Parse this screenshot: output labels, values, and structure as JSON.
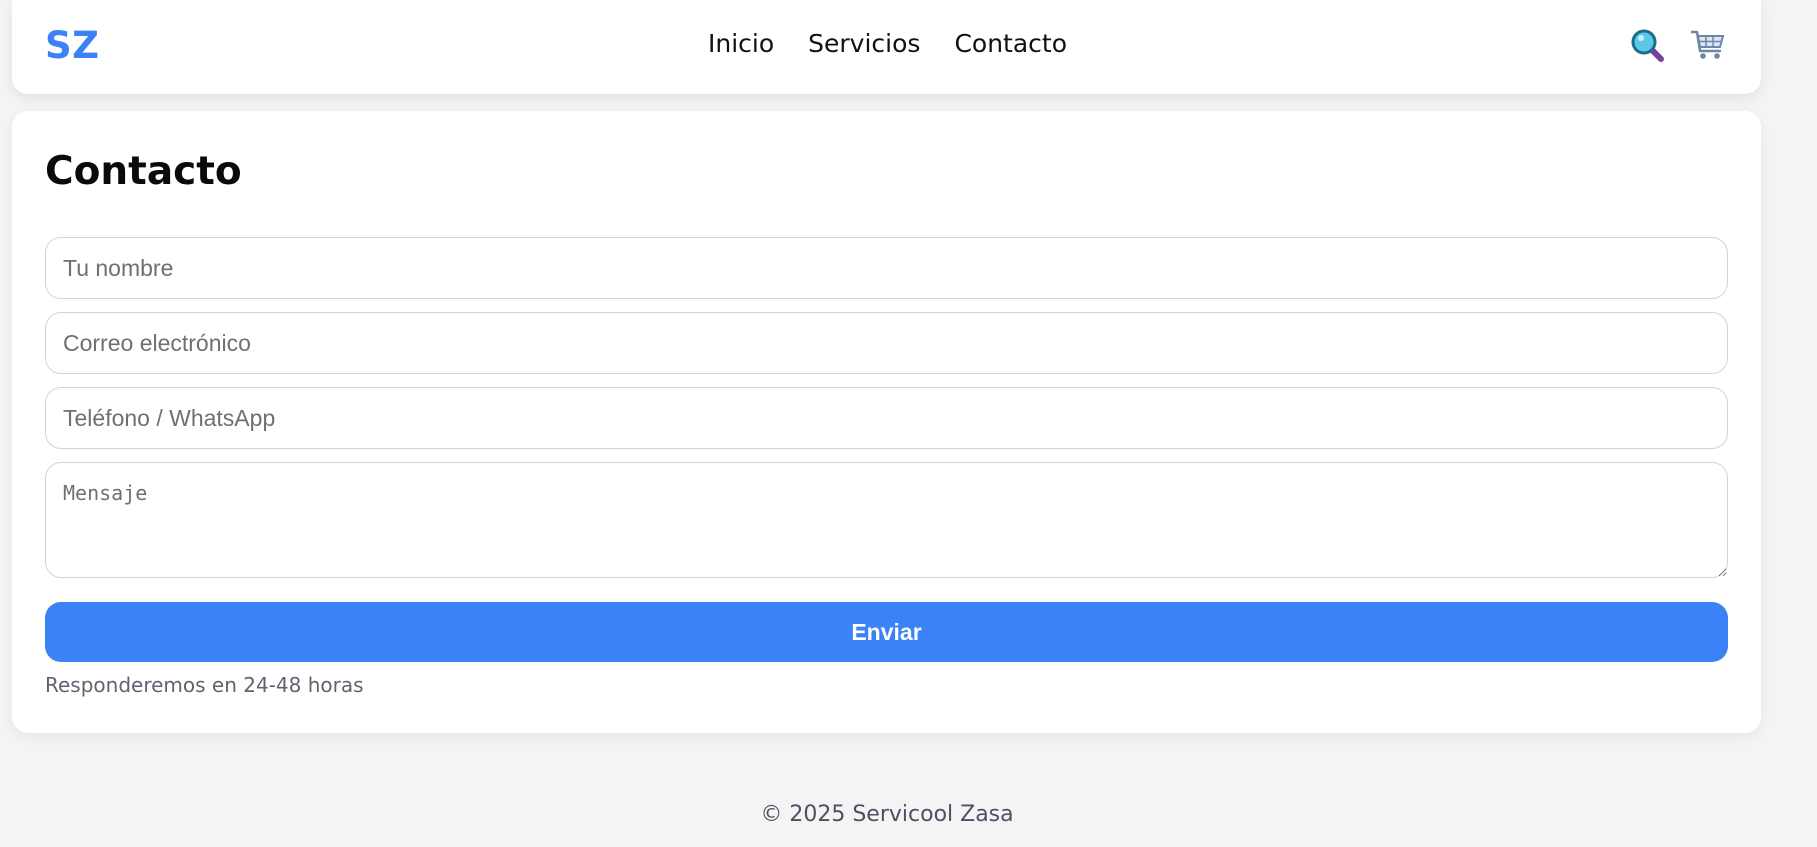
{
  "header": {
    "logo": "SZ",
    "nav": [
      "Inicio",
      "Servicios",
      "Contacto"
    ],
    "icons": {
      "search": "search-icon",
      "cart": "cart-icon"
    }
  },
  "contact": {
    "title": "Contacto",
    "name_placeholder": "Tu nombre",
    "email_placeholder": "Correo electrónico",
    "phone_placeholder": "Teléfono / WhatsApp",
    "message_placeholder": "Mensaje",
    "submit_label": "Enviar",
    "note": "Responderemos en 24-48 horas"
  },
  "footer": {
    "text": "© 2025 Servicool Zasa"
  },
  "colors": {
    "accent": "#3b82f6",
    "background": "#f4f4f4",
    "card": "#ffffff"
  }
}
